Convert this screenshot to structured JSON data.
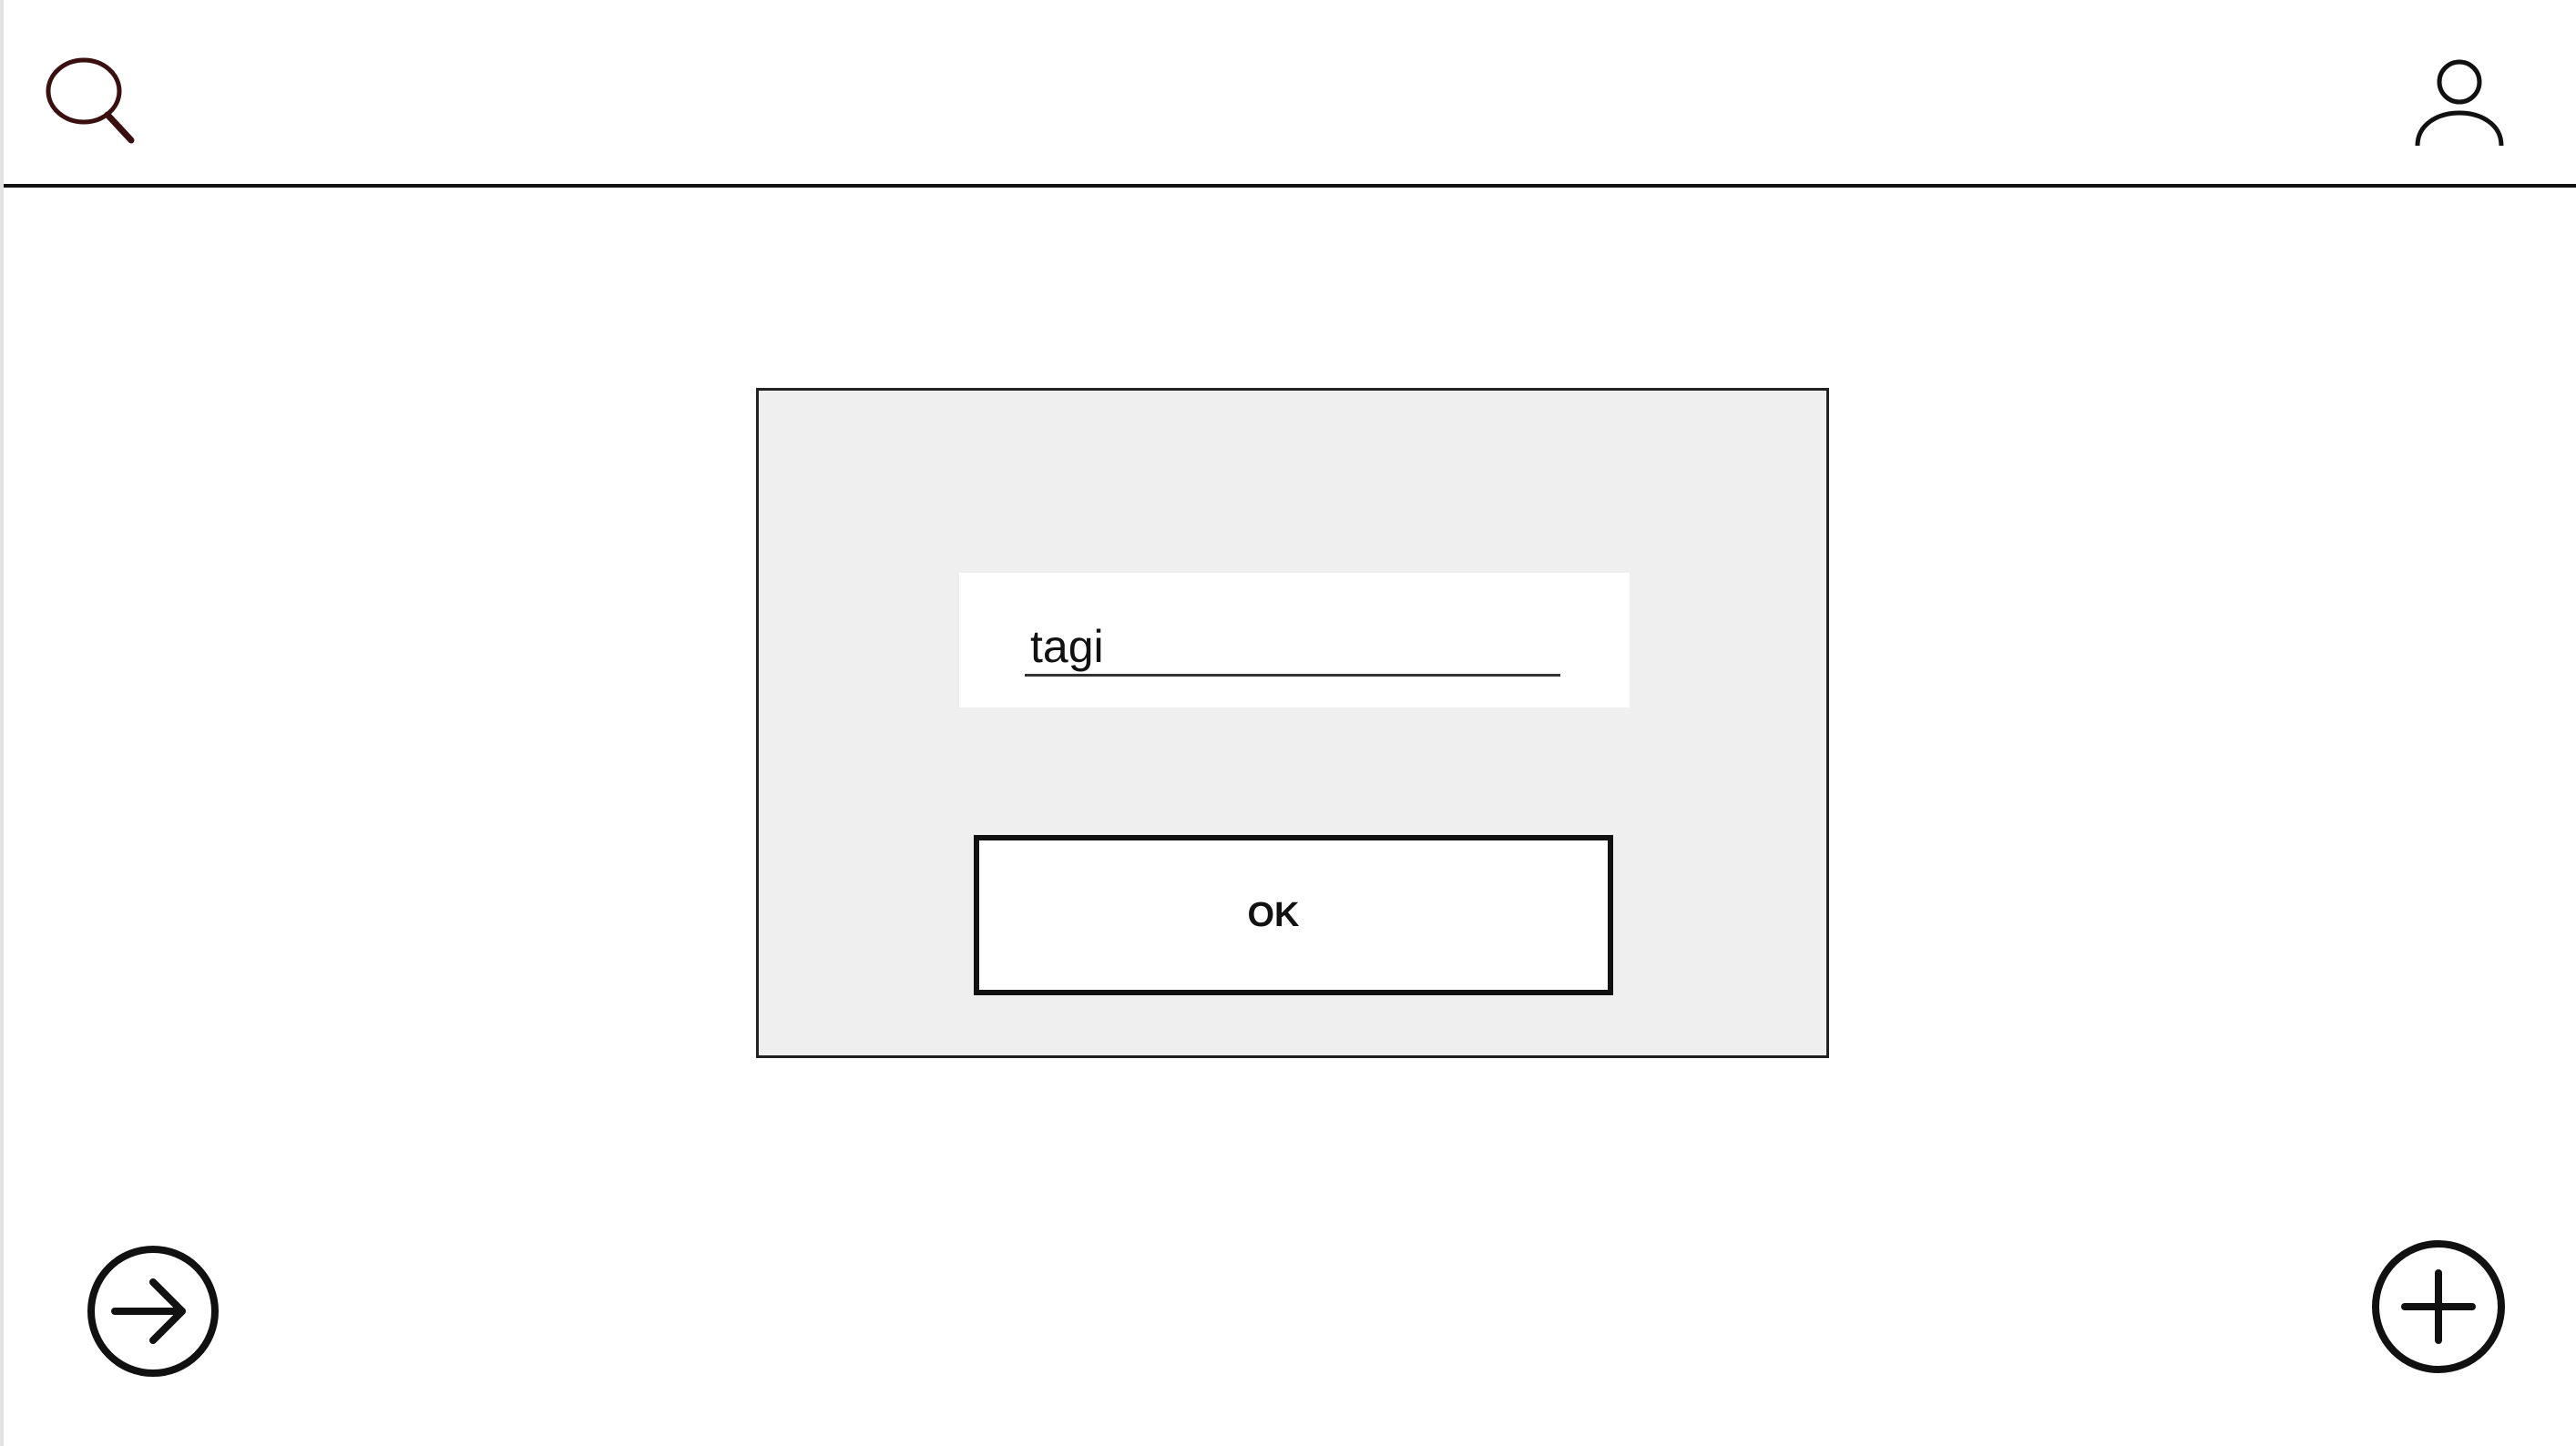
{
  "header": {
    "search_icon": "search-icon",
    "profile_icon": "user-icon"
  },
  "dialog": {
    "input": {
      "value": "tagi"
    },
    "ok_label": "OK"
  },
  "footer": {
    "next_icon": "arrow-right-circle-icon",
    "add_icon": "plus-circle-icon"
  },
  "colors": {
    "search_icon_stroke": "#3a0f0f",
    "ink": "#111111",
    "dialog_background": "#efefef",
    "page_background": "#ffffff"
  }
}
